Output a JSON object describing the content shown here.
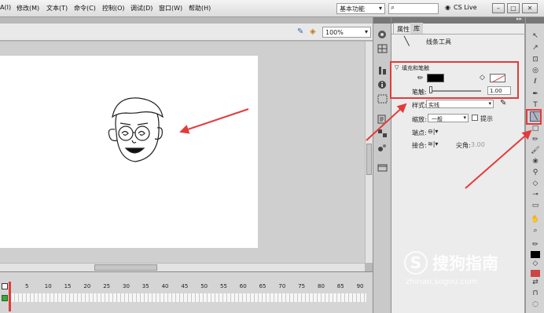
{
  "menubar": {
    "items": [
      "A(I)",
      "修改(M)",
      "文本(T)",
      "命令(C)",
      "控制(O)",
      "调试(D)",
      "窗口(W)",
      "帮助(H)"
    ],
    "workspace": "基本功能",
    "search_placeholder": "",
    "cs_live": "CS Live"
  },
  "stage": {
    "zoom": "100%"
  },
  "timeline": {
    "frame_numbers": [
      "5",
      "10",
      "15",
      "20",
      "25",
      "30",
      "35",
      "40",
      "45",
      "50",
      "55",
      "60",
      "65",
      "70",
      "75",
      "80",
      "85",
      "90"
    ]
  },
  "panel": {
    "tab_properties": "属性",
    "tab_library": "库",
    "tool_name": "线条工具",
    "fill_stroke_header": "填充和笔触",
    "stroke_size_label": "笔触:",
    "stroke_size_value": "1.00",
    "style_label": "样式:",
    "style_value": "实线",
    "scale_label": "缩放:",
    "scale_value": "一般",
    "hint_label": "提示",
    "cap_label": "端点:",
    "join_label": "接合:",
    "miter_label": "尖角:",
    "miter_value": "3.00"
  },
  "watermark": {
    "brand": "搜狗指南",
    "url": "zhinan.sogou.com"
  },
  "colors": {
    "annotation_red": "#e43a3a",
    "stroke_color": "#000000",
    "stage_bg": "#ffffff"
  }
}
